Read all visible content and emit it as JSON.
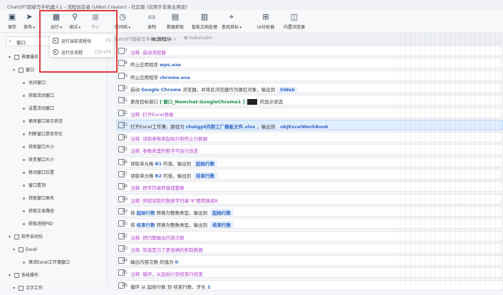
{
  "window": {
    "title": "ChatGPT超级写手机器人1 - 流程创造者 (UiBot Creator) - 社区版 (仅用于非商业用途)"
  },
  "toolbar": {
    "save": "保存",
    "publish": "发布",
    "run": "运行",
    "debug": "调试",
    "stop": "停止",
    "timeline": "时间线",
    "record": "录制",
    "data_scrape": "数据抓取",
    "smart_text": "智能文档处理",
    "find_var": "查找目标",
    "ui_analyzer": "UI分析器",
    "browser": "内置浏览器"
  },
  "run_menu": {
    "items": [
      {
        "label": "运行当前流程块",
        "shortcut": "F5"
      },
      {
        "label": "运行全流程",
        "shortcut": "Ctrl+F5"
      }
    ]
  },
  "sidebar": {
    "search_value": "窗口",
    "tree": [
      {
        "label": "界面操作",
        "level": 0,
        "state": "open"
      },
      {
        "label": "窗口",
        "level": 1,
        "state": "open"
      },
      {
        "label": "关闭窗口",
        "level": 2
      },
      {
        "label": "获取活动窗口",
        "level": 2
      },
      {
        "label": "设置活动窗口",
        "level": 2
      },
      {
        "label": "更改窗口显示状态",
        "level": 2
      },
      {
        "label": "判断窗口是否存在",
        "level": 2
      },
      {
        "label": "获取窗口大小",
        "level": 2
      },
      {
        "label": "改变窗口大小",
        "level": 2
      },
      {
        "label": "移动窗口位置",
        "level": 2
      },
      {
        "label": "窗口置顶",
        "level": 2
      },
      {
        "label": "获取窗口类名",
        "level": 2
      },
      {
        "label": "获取文本路径",
        "level": 2
      },
      {
        "label": "获取进程PID",
        "level": 2
      },
      {
        "label": "软件自动化",
        "level": 0,
        "state": "open"
      },
      {
        "label": "Excel",
        "level": 1,
        "state": "open"
      },
      {
        "label": "激活Excel工作簿窗口",
        "level": 2
      },
      {
        "label": "系统操作",
        "level": 0,
        "state": "open"
      },
      {
        "label": "文字工作",
        "level": 1,
        "state": "open"
      }
    ]
  },
  "tabs": [
    {
      "label": "ChatGPT超级写手机器人1",
      "active": false
    },
    {
      "label": "流程块",
      "active": true
    },
    {
      "label": "hubstudio",
      "active": false
    }
  ],
  "colors": {
    "accent": "#2f66c5",
    "comment": "#b03ccf",
    "selected": "#dfeeff",
    "highlight": "#e03b3b"
  },
  "rows": [
    {
      "num": "7",
      "type": "comment",
      "text": "注释: 启动流程器"
    },
    {
      "num": "8",
      "type": "cmd",
      "text": "终止应用程序",
      "vals": [
        "wps.exe"
      ]
    },
    {
      "num": "9",
      "type": "cmd",
      "text": "终止应用程序",
      "vals": [
        "chrome.exe"
      ]
    },
    {
      "num": "10",
      "type": "cmd",
      "text": "启动",
      "after": "浏览器，并将此浏览器作为操控对象，输出到",
      "vals": [
        "Google Chrome"
      ],
      "chip": "hWeb"
    },
    {
      "num": "11",
      "type": "cmd",
      "text": "更改目标窗口",
      "after": "的显示状态",
      "vals": [
        "[ 窗口_Newchat-GoogleChrome1 ]"
      ],
      "blk": true
    },
    {
      "num": "12",
      "type": "comment",
      "text": "注释: 打开Excel表格"
    },
    {
      "num": "13",
      "type": "cmd",
      "sel": true,
      "text": "打开Excel工作簿，路径为",
      "after": "，输出到",
      "vals": [
        "chatgpt内容工厂模板文件.xlsx"
      ],
      "chip": "objExcelWorkBook"
    },
    {
      "num": "14",
      "type": "comment",
      "text": "注释: 读取参数表起始行和终止行数据"
    },
    {
      "num": "15",
      "type": "comment",
      "text": "注释: 参数表里的数字可自行改变"
    },
    {
      "num": "16",
      "type": "cmd",
      "text": "读取单元格",
      "after": "的值，输出到",
      "vals": [
        "B1"
      ],
      "chip": "起始行数"
    },
    {
      "num": "17",
      "type": "cmd",
      "text": "读取单元格",
      "after": "的值，输出到",
      "vals": [
        "B2"
      ],
      "chip": "结束行数"
    },
    {
      "num": "18",
      "type": "comment",
      "text": "注释: 把字符串转换成整数"
    },
    {
      "num": "19",
      "type": "comment",
      "text": "注释: 例如读取的数据字符串\"8\"要转换成8"
    },
    {
      "num": "20",
      "type": "cmd",
      "text": "将",
      "mid": "转换为整数类型，输出到",
      "lead": "起始行数",
      "chip": "起始行数"
    },
    {
      "num": "21",
      "type": "cmd",
      "text": "将",
      "mid": "转换为整数类型，输出到",
      "lead": "结束行数",
      "chip": "结束行数"
    },
    {
      "num": "22",
      "type": "comment",
      "text": "注释: 把问题输出内容次数"
    },
    {
      "num": "23",
      "type": "comment",
      "text": "注释: 就值是为了更准确的抓取数据"
    },
    {
      "num": "24",
      "type": "cmd",
      "text": "输出内容次数 的值为",
      "vals": [
        "0"
      ]
    },
    {
      "num": "25",
      "type": "comment",
      "text": "注释: 循环，从起始行到结束行结束"
    },
    {
      "num": "26",
      "type": "cmd",
      "text": "循环 从",
      "mid": "起始行数 到 结束行数，步长",
      "lead": "",
      "vals": [
        "1"
      ]
    }
  ]
}
